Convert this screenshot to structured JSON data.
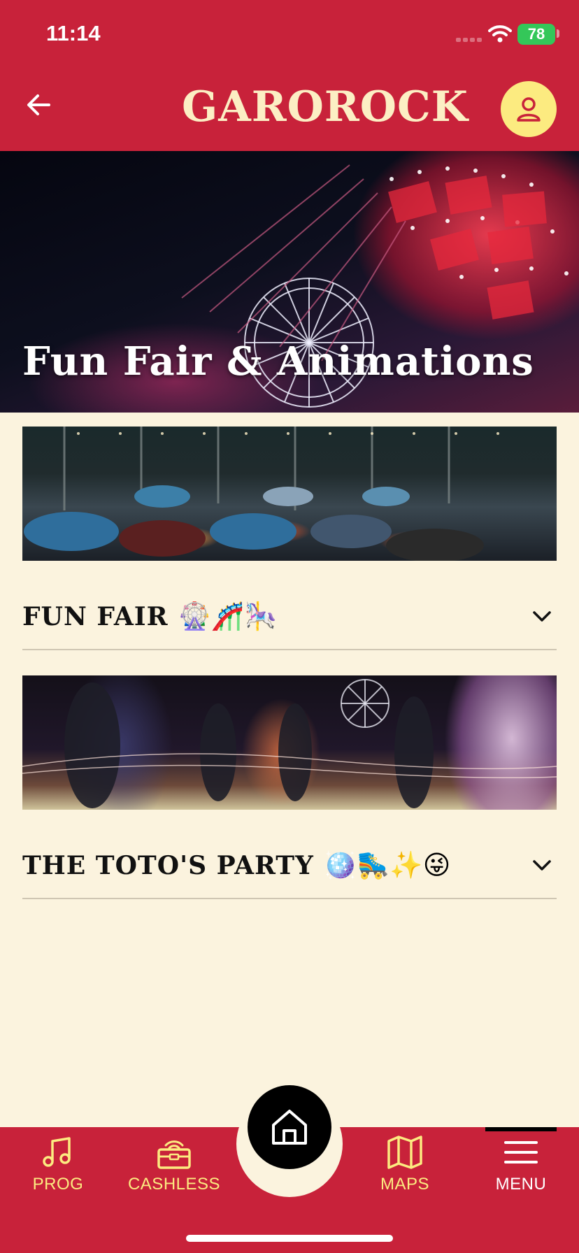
{
  "status_bar": {
    "time": "11:14",
    "battery": "78"
  },
  "header": {
    "logo": "GAROROCK",
    "back_icon": "arrow-left-icon",
    "profile_icon": "user-icon"
  },
  "hero": {
    "title": "Fun Fair & Animations"
  },
  "sections": [
    {
      "title": "FUN FAIR",
      "emoji": "🎡🎢🎠",
      "expanded": false
    },
    {
      "title": "THE TOTO'S PARTY",
      "emoji": "🪩🛼✨😜",
      "expanded": false
    }
  ],
  "bottom_nav": {
    "items": [
      {
        "label": "PROG",
        "icon": "music-note-icon"
      },
      {
        "label": "CASHLESS",
        "icon": "wallet-icon"
      },
      {
        "label": "MAPS",
        "icon": "map-icon"
      },
      {
        "label": "MENU",
        "icon": "hamburger-icon"
      }
    ],
    "home_icon": "home-icon",
    "active": "MENU"
  },
  "colors": {
    "brand_red": "#C8223A",
    "cream": "#FBF3DE",
    "accent_yellow": "#FCEB80"
  }
}
